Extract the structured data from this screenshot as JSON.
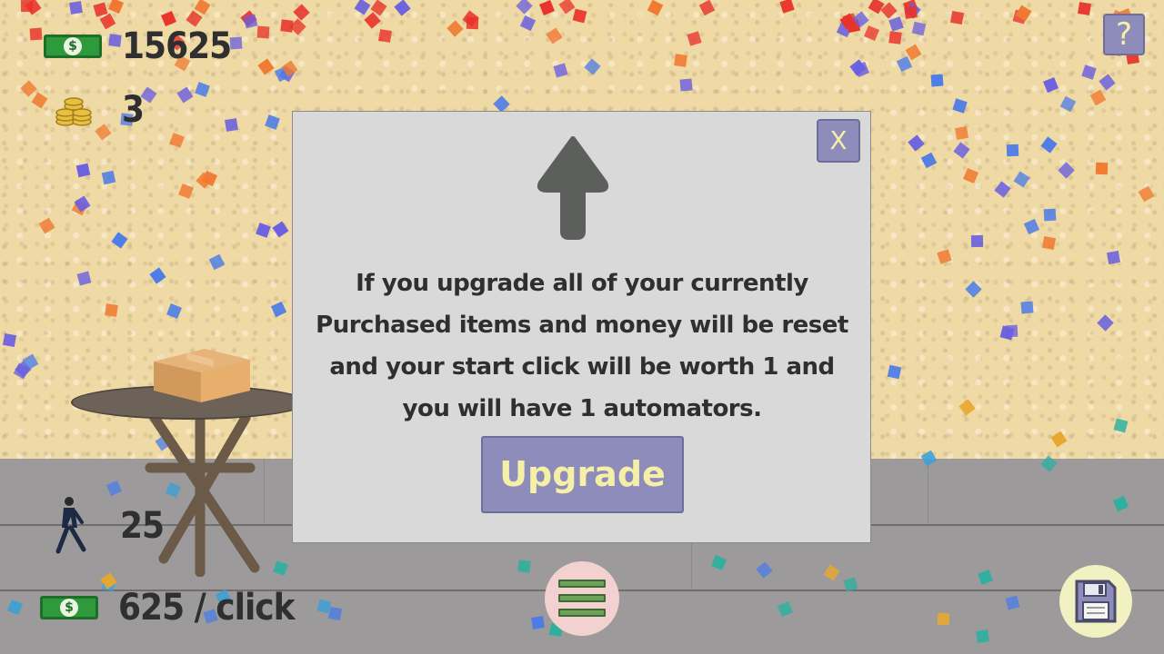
{
  "hud": {
    "money": "15625",
    "money_icon": "cash-icon",
    "gold": "3",
    "gold_icon": "coins-icon",
    "automators": "25",
    "automator_icon": "walking-man-icon",
    "per_click": "625 / click",
    "per_click_icon": "cash-icon"
  },
  "help_button": {
    "label": "?"
  },
  "upgrade_dialog": {
    "close_label": "X",
    "icon": "up-arrow-icon",
    "message": "If you upgrade all of your currently Purchased items and money will be reset and your start click will be worth 1 and you will have 1 automators.",
    "button_label": "Upgrade"
  },
  "bottom_bar": {
    "menu_icon": "menu-icon",
    "save_icon": "save-icon"
  },
  "colors": {
    "button": "#8d8cba",
    "button_text": "#f5efa8",
    "wall": "#efd9a4",
    "floor": "#9c9a9a",
    "dialog": "#d9d9d9"
  }
}
